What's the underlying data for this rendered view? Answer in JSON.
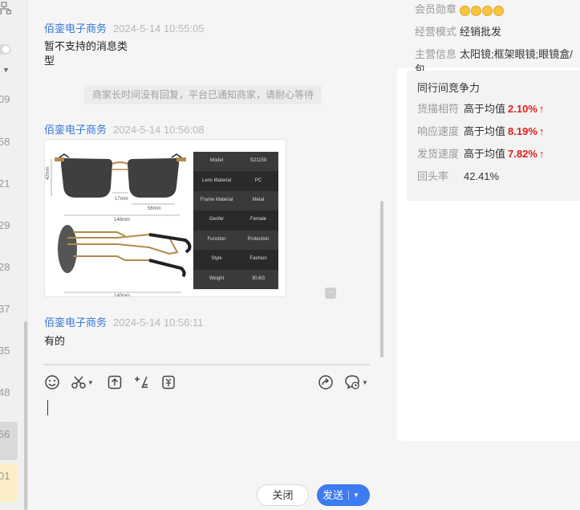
{
  "sidebar": {
    "numbers": [
      "09",
      "58",
      "21",
      "29",
      "28",
      "37",
      "35",
      "48",
      "56",
      "01"
    ]
  },
  "messages": [
    {
      "sender": "佰銮电子商务",
      "time": "2024-5-14 10:55:05",
      "text_line1": "暂不支持的消息类",
      "text_line2": "型"
    },
    {
      "sender": "佰銮电子商务",
      "time": "2024-5-14 10:56:08"
    },
    {
      "sender": "佰銮电子商务",
      "time": "2024-5-14 10:56:11",
      "text": "有的"
    }
  ],
  "system_notice": "商家长时间没有回复，平台已通知商家，请耐心等待",
  "product_image": {
    "dims": {
      "lens_height": "42mm",
      "bridge": "17mm",
      "lens_width": "56mm",
      "total_width": "148mm",
      "temple_length": "140mm"
    },
    "specs": [
      {
        "label": "Model",
        "value": "S21159"
      },
      {
        "label": "Lens Material",
        "value": "PC"
      },
      {
        "label": "Frame Material",
        "value": "Metal"
      },
      {
        "label": "Genfer",
        "value": "Female"
      },
      {
        "label": "Function",
        "value": "Protection"
      },
      {
        "label": "Style",
        "value": "Fashion"
      },
      {
        "label": "Weight",
        "value": "30.6G"
      }
    ]
  },
  "composer": {
    "close_label": "关闭",
    "send_label": "发送"
  },
  "shop_info": {
    "medal_label": "会员勋章",
    "medal_count": 4,
    "mode_label": "经营模式",
    "mode_value": "经销批发",
    "main_label": "主营信息",
    "main_value": "太阳镜;框架眼镜;眼镜盒/包"
  },
  "competitiveness": {
    "title": "同行间竞争力",
    "rows": [
      {
        "label": "货描相符",
        "text": "高于均值",
        "pct": "2.10%",
        "arrow": "↑"
      },
      {
        "label": "响应速度",
        "text": "高于均值",
        "pct": "8.19%",
        "arrow": "↑"
      },
      {
        "label": "发货速度",
        "text": "高于均值",
        "pct": "7.82%",
        "arrow": "↑"
      }
    ],
    "repeat_label": "回头率",
    "repeat_value": "42.41%"
  },
  "colors": {
    "link": "#3a78d8",
    "accent": "#3c7bf0",
    "up": "#e0201e"
  }
}
